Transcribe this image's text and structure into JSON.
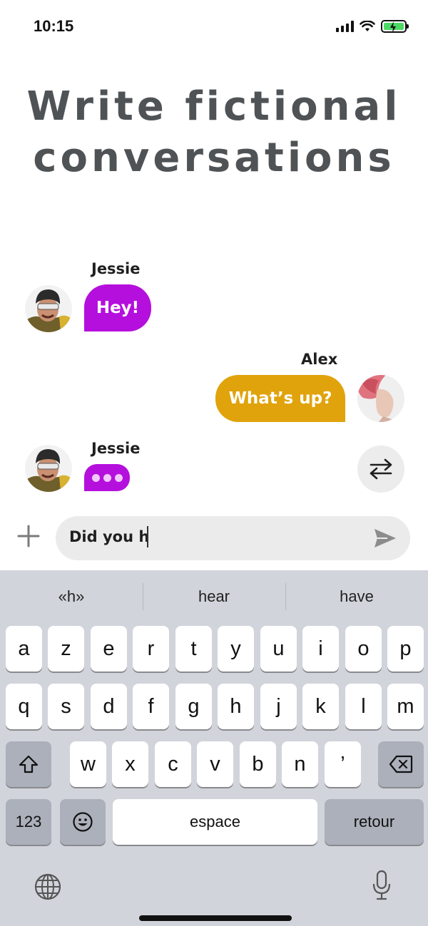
{
  "status_bar": {
    "time": "10:15",
    "icons": [
      "signal-icon",
      "wifi-icon",
      "battery-charging-icon"
    ],
    "battery_color": "#4cd964"
  },
  "headline": "Write fictional conversations",
  "chat": {
    "messages": [
      {
        "sender": "Jessie",
        "text": "Hey!",
        "side": "left",
        "color": "#b50fdd"
      },
      {
        "sender": "Alex",
        "text": "What’s up?",
        "side": "right",
        "color": "#e0a30c"
      },
      {
        "sender": "Jessie",
        "typing": true,
        "side": "left",
        "color": "#b50fdd"
      }
    ],
    "swap_icon": "swap-arrows-icon"
  },
  "composer": {
    "value": "Did you h",
    "add_icon": "plus-icon",
    "send_icon": "send-icon"
  },
  "keyboard": {
    "suggestions": [
      "«h»",
      "hear",
      "have"
    ],
    "row1": [
      "a",
      "z",
      "e",
      "r",
      "t",
      "y",
      "u",
      "i",
      "o",
      "p"
    ],
    "row2": [
      "q",
      "s",
      "d",
      "f",
      "g",
      "h",
      "j",
      "k",
      "l",
      "m"
    ],
    "row3": [
      "w",
      "x",
      "c",
      "v",
      "b",
      "n",
      "’"
    ],
    "numbers_label": "123",
    "space_label": "espace",
    "return_label": "retour",
    "icons": [
      "shift-icon",
      "backspace-icon",
      "emoji-icon",
      "globe-icon",
      "microphone-icon"
    ]
  }
}
